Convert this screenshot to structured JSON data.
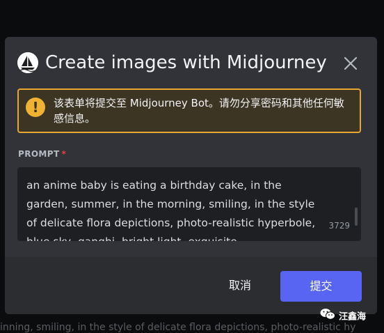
{
  "background_text": "inning, smiling, in the style of delicate flora depictions, photo-realistic hy",
  "modal": {
    "title": "Create images with Midjourney",
    "logo_icon": "midjourney-boat-logo",
    "close_icon": "close-icon",
    "warning": {
      "icon": "exclamation-icon",
      "text": "该表单将提交至 Midjourney Bot。请勿分享密码和其他任何敏感信息。"
    },
    "prompt_label": "PROMPT",
    "required_marker": "*",
    "prompt_value": "an anime baby is eating a birthday cake, in the garden, summer, in the morning, smiling, in the style of delicate flora depictions, photo-realistic hyperbole, blue sky, ganghi, bright light, exquisite",
    "char_counter": "3729",
    "cancel_label": "取消",
    "submit_label": "提交"
  },
  "watermark": {
    "icon": "wechat-icon",
    "text": "汪鑫海"
  },
  "colors": {
    "modal_bg": "#313338",
    "footer_bg": "#2b2d31",
    "warning_border": "#e6a830",
    "primary_button": "#5865f2",
    "required": "#f23f43"
  }
}
